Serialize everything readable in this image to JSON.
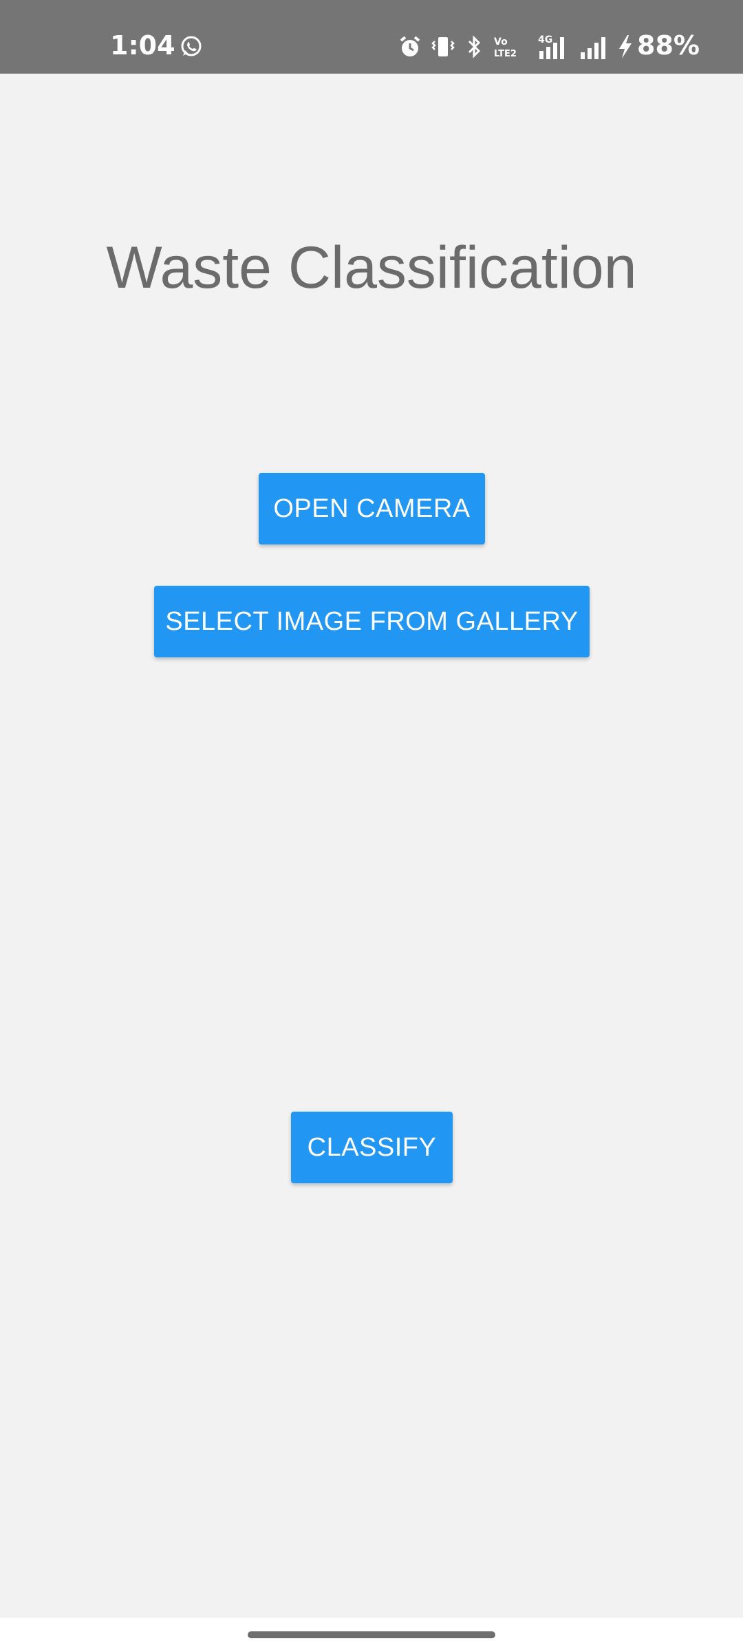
{
  "status_bar": {
    "time": "1:04",
    "battery": "88%",
    "icons": [
      "whatsapp-icon",
      "alarm-icon",
      "vibrate-icon",
      "bluetooth-icon",
      "volte-icon",
      "signal-4g-icon",
      "signal-icon",
      "charging-icon"
    ]
  },
  "app": {
    "title": "Waste Classification",
    "open_camera_label": "OPEN CAMERA",
    "select_gallery_label": "SELECT IMAGE FROM GALLERY",
    "classify_label": "CLASSIFY"
  },
  "colors": {
    "status_bar_bg": "#757575",
    "background": "#f2f2f2",
    "button_bg": "#2196f3",
    "button_text": "#ffffff",
    "title_text": "#6b6b6b"
  }
}
